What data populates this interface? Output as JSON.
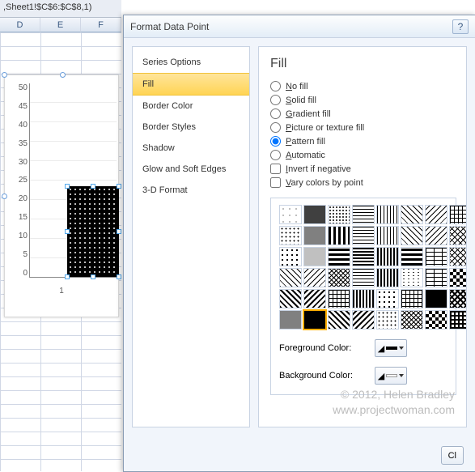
{
  "formula_bar": ",Sheet1!$C$6:$C$8,1)",
  "columns": [
    "D",
    "E",
    "F"
  ],
  "chart_data": {
    "type": "bar",
    "categories": [
      "1"
    ],
    "values": [
      23
    ],
    "title": "",
    "xlabel": "",
    "ylabel": "",
    "ylim": [
      0,
      50
    ],
    "yticks": [
      0,
      5,
      10,
      15,
      20,
      25,
      30,
      35,
      40,
      45,
      50
    ]
  },
  "chart_bar_xlabel": "1",
  "dialog": {
    "title": "Format Data Point",
    "help": "?",
    "nav": [
      {
        "label": "Series Options",
        "selected": false
      },
      {
        "label": "Fill",
        "selected": true
      },
      {
        "label": "Border Color",
        "selected": false
      },
      {
        "label": "Border Styles",
        "selected": false
      },
      {
        "label": "Shadow",
        "selected": false
      },
      {
        "label": "Glow and Soft Edges",
        "selected": false
      },
      {
        "label": "3-D Format",
        "selected": false
      }
    ],
    "panel_title": "Fill",
    "fill_options": [
      {
        "id": "nofill",
        "u": "N",
        "label": "No fill",
        "checked": false
      },
      {
        "id": "solid",
        "u": "S",
        "label": "Solid fill",
        "checked": false
      },
      {
        "id": "gradient",
        "u": "G",
        "label": "Gradient fill",
        "checked": false
      },
      {
        "id": "picture",
        "u": "P",
        "label": "Picture or texture fill",
        "checked": false
      },
      {
        "id": "pattern",
        "u": "P",
        "label": "Pattern fill",
        "checked": true
      },
      {
        "id": "auto",
        "u": "A",
        "label": "Automatic",
        "checked": false
      }
    ],
    "checkboxes": [
      {
        "id": "invert",
        "u": "I",
        "label": "Invert if negative",
        "checked": false
      },
      {
        "id": "vary",
        "u": "V",
        "label": "Vary colors by point",
        "checked": false
      }
    ],
    "foreground_label": "Foreground Color:",
    "background_label": "Background Color:",
    "foreground_color": "#000000",
    "background_color": "#ffffff",
    "close_label": "Cl",
    "selected_swatch_index": 41
  },
  "patterns": [
    "p-sparse",
    "p-gray75",
    "p-dots-s",
    "p-hlines",
    "p-vlines",
    "p-diag1",
    "p-diag2",
    "p-grid",
    "p-dots-m",
    "p-gray50",
    "p-dash-h",
    "p-hlines",
    "p-vlines",
    "p-diag1",
    "p-diag2",
    "p-xhatch",
    "p-dots-l",
    "p-gray25",
    "p-dash-v",
    "p-hlines-t",
    "p-vlines-t",
    "p-dash-v",
    "p-brick",
    "p-xhatch",
    "p-diag1",
    "p-diag2",
    "p-zig",
    "p-hlines",
    "p-vlines-t",
    "p-wave",
    "p-brick",
    "p-check",
    "p-diag1-t",
    "p-diag2-t",
    "p-grid",
    "p-vlines-t",
    "p-dots-l",
    "p-grid",
    "p-solid",
    "p-xhatch-t",
    "p-gray50",
    "p-solid",
    "p-diag1-t",
    "p-diag2-t",
    "p-dots-m",
    "p-zig",
    "p-check",
    "p-grid-t"
  ],
  "credit_line1": "© 2012, Helen Bradley",
  "credit_line2": "www.projectwoman.com"
}
